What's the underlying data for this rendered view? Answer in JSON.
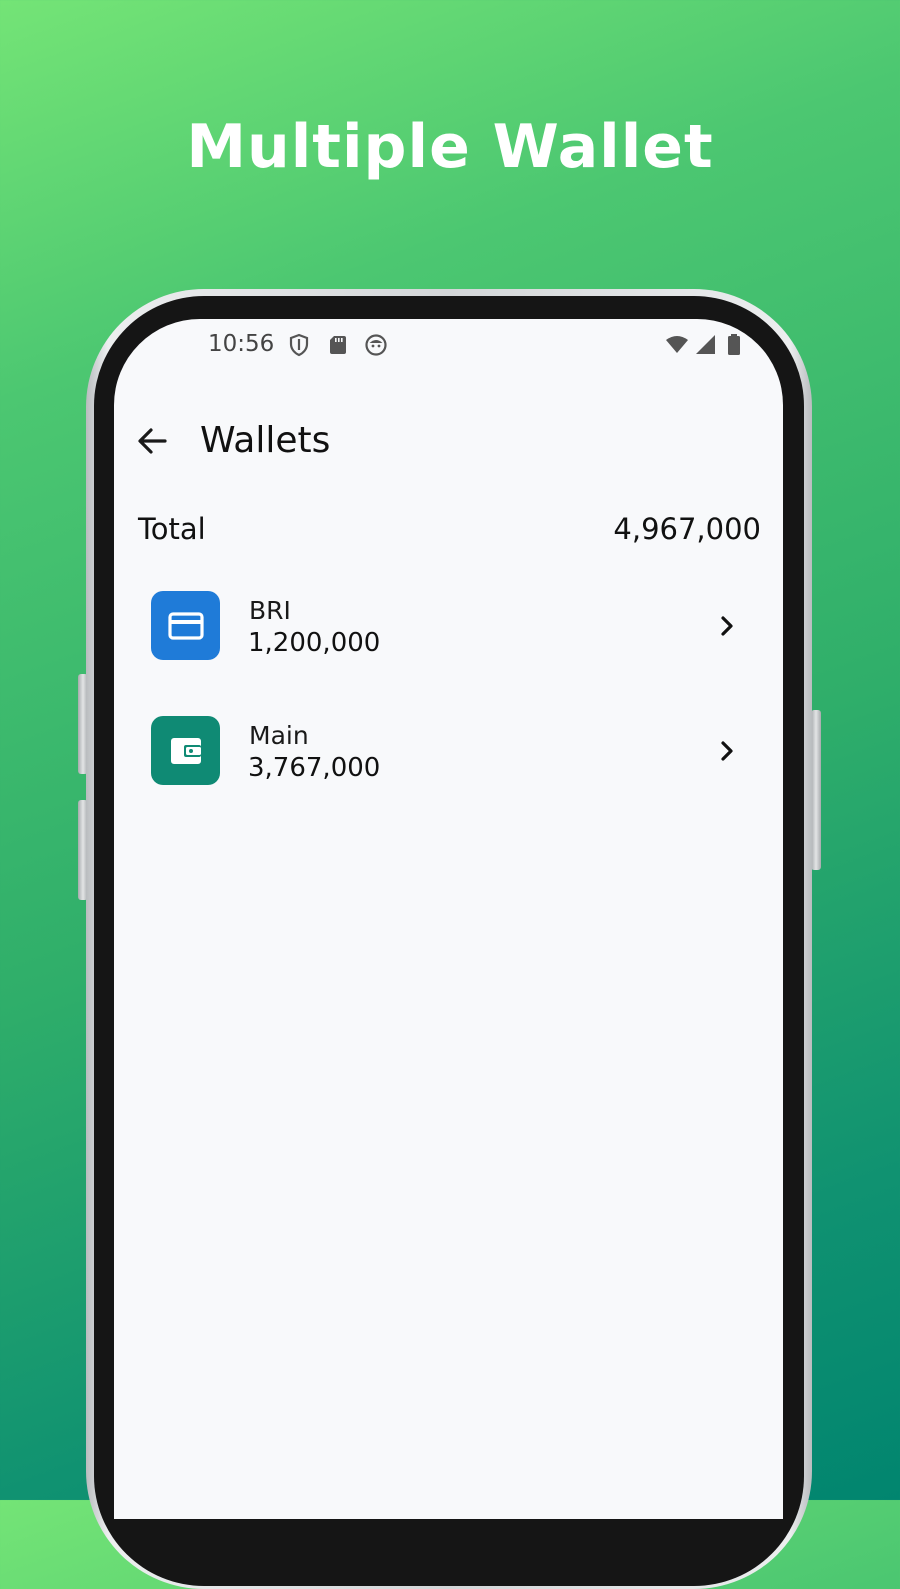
{
  "headline": "Multiple Wallet",
  "status_bar": {
    "time": "10:56",
    "left_icons": [
      "shield-icon",
      "sd-card-icon",
      "face-icon"
    ],
    "right_icons": [
      "wifi-icon",
      "signal-icon",
      "battery-icon"
    ]
  },
  "app_bar": {
    "title": "Wallets",
    "back_icon": "arrow-back-icon"
  },
  "summary": {
    "label": "Total",
    "value": "4,967,000"
  },
  "wallets": [
    {
      "name": "BRI",
      "amount": "1,200,000",
      "icon": "credit-card-icon",
      "color": "#1f7bd8"
    },
    {
      "name": "Main",
      "amount": "3,767,000",
      "icon": "wallet-icon",
      "color": "#0f8a74"
    }
  ],
  "colors": {
    "background_top": "#74e476",
    "background_bottom": "#01856f",
    "screen": "#f8f9fb"
  }
}
